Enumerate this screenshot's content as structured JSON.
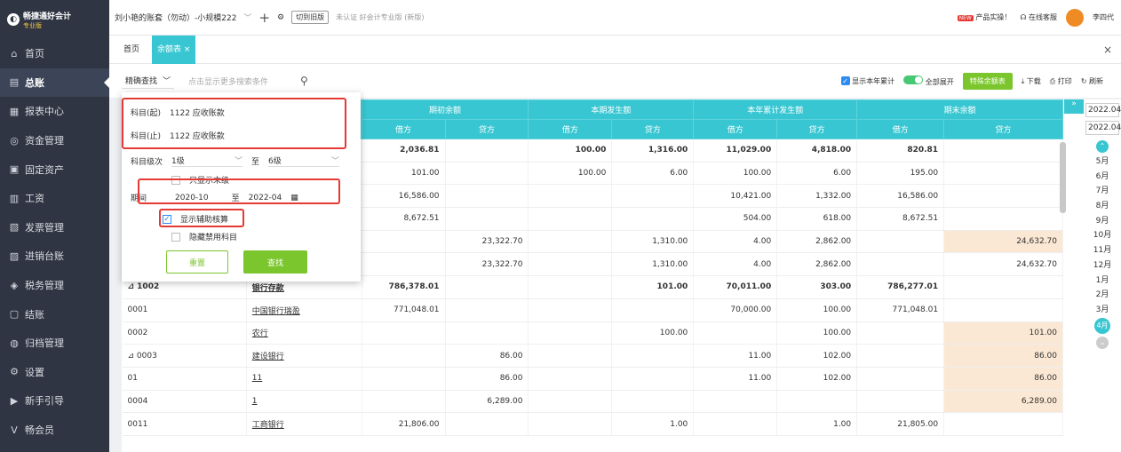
{
  "brand": {
    "name": "畅捷通好会计",
    "edition": "专业版"
  },
  "sidebar": {
    "items": [
      {
        "label": "首页",
        "icon": "home-icon",
        "glyph": "⌂"
      },
      {
        "label": "总账",
        "icon": "ledger-icon",
        "glyph": "▤",
        "active": true
      },
      {
        "label": "报表中心",
        "icon": "chart-icon",
        "glyph": "▦"
      },
      {
        "label": "资金管理",
        "icon": "fund-icon",
        "glyph": "◎"
      },
      {
        "label": "固定资产",
        "icon": "asset-icon",
        "glyph": "▣"
      },
      {
        "label": "工资",
        "icon": "salary-icon",
        "glyph": "▥"
      },
      {
        "label": "发票管理",
        "icon": "invoice-icon",
        "glyph": "▧"
      },
      {
        "label": "进销台账",
        "icon": "inventory-icon",
        "glyph": "▨"
      },
      {
        "label": "税务管理",
        "icon": "tax-icon",
        "glyph": "◈"
      },
      {
        "label": "结账",
        "icon": "close-book-icon",
        "glyph": "▢"
      },
      {
        "label": "归档管理",
        "icon": "archive-icon",
        "glyph": "◍"
      },
      {
        "label": "设置",
        "icon": "settings-icon",
        "glyph": "⚙"
      },
      {
        "label": "新手引导",
        "icon": "guide-icon",
        "glyph": "▶"
      },
      {
        "label": "畅会员",
        "icon": "vip-icon",
        "glyph": "V"
      }
    ]
  },
  "topbar": {
    "account": "刘小艳的账套（勿动）-小规模222",
    "switch_old": "切到旧版",
    "unauth": "未认证 好会计专业版 (新版)",
    "promo": "产品实操！",
    "service": "在线客服",
    "user": "李四代"
  },
  "tabs": [
    "首页",
    "余额表 ×"
  ],
  "toolbar": {
    "mode": "精确查找",
    "placeholder": "点击显示更多搜索条件",
    "show_year": "显示本年累计",
    "expand_all": "全部展开",
    "special": "特殊余额表",
    "download": "下载",
    "print": "打印",
    "refresh": "刷新"
  },
  "filter": {
    "subj_from_label": "科目(起)",
    "subj_from": "1122 应收账款",
    "subj_to_label": "科目(止)",
    "subj_to": "1122 应收账款",
    "level_label": "科目级次",
    "level_from": "1级",
    "level_to_label": "至",
    "level_to": "6级",
    "only_leaf": "只显示末级",
    "period_label": "期间",
    "period_from": "2020-10",
    "period_sep": "至",
    "period_to": "2022-04",
    "aux": "显示辅助核算",
    "hide_disabled": "隐藏禁用科目",
    "reset": "重置",
    "search": "查找"
  },
  "table": {
    "groups": [
      "期初余额",
      "本期发生额",
      "本年累计发生额",
      "期末余额"
    ],
    "sub": [
      "借方",
      "贷方",
      "借方",
      "贷方",
      "借方",
      "贷方",
      "借方",
      "贷方"
    ],
    "rows": [
      {
        "code": "",
        "name": "",
        "v": [
          "2,036.81",
          "",
          "100.00",
          "1,316.00",
          "11,029.00",
          "4,818.00",
          "820.81",
          ""
        ],
        "bold": true
      },
      {
        "code": "",
        "name": "",
        "v": [
          "101.00",
          "",
          "100.00",
          "6.00",
          "100.00",
          "6.00",
          "195.00",
          ""
        ]
      },
      {
        "code": "",
        "name": "",
        "v": [
          "16,586.00",
          "",
          "",
          "",
          "10,421.00",
          "1,332.00",
          "16,586.00",
          ""
        ]
      },
      {
        "code": "",
        "name": "",
        "v": [
          "8,672.51",
          "",
          "",
          "",
          "504.00",
          "618.00",
          "8,672.51",
          ""
        ]
      },
      {
        "code": "",
        "name": "",
        "v": [
          "",
          "23,322.70",
          "",
          "1,310.00",
          "4.00",
          "2,862.00",
          "",
          "24,632.70"
        ],
        "peach": true
      },
      {
        "code": "",
        "name": "",
        "v": [
          "",
          "23,322.70",
          "",
          "1,310.00",
          "4.00",
          "2,862.00",
          "",
          "24,632.70"
        ]
      },
      {
        "code": "⊿ 1002",
        "name": "银行存款",
        "v": [
          "786,378.01",
          "",
          "",
          "101.00",
          "70,011.00",
          "303.00",
          "786,277.01",
          ""
        ],
        "bold": true
      },
      {
        "code": "0001",
        "name": "中国银行瑞盈",
        "v": [
          "771,048.01",
          "",
          "",
          "",
          "70,000.00",
          "100.00",
          "771,048.01",
          ""
        ]
      },
      {
        "code": "0002",
        "name": "农行",
        "v": [
          "",
          "",
          "",
          "100.00",
          "",
          "100.00",
          "",
          "101.00"
        ],
        "peach": true
      },
      {
        "code": "⊿ 0003",
        "name": "建设银行",
        "v": [
          "",
          "86.00",
          "",
          "",
          "11.00",
          "102.00",
          "",
          "86.00"
        ],
        "peach": true
      },
      {
        "code": "01",
        "name": "11",
        "v": [
          "",
          "86.00",
          "",
          "",
          "11.00",
          "102.00",
          "",
          "86.00"
        ],
        "peach": true
      },
      {
        "code": "0004",
        "name": "1",
        "v": [
          "",
          "6,289.00",
          "",
          "",
          "",
          "",
          "",
          "6,289.00"
        ],
        "peach": true
      },
      {
        "code": "0011",
        "name": "工商银行",
        "v": [
          "21,806.00",
          "",
          "",
          "1.00",
          "",
          "1.00",
          "21,805.00",
          ""
        ]
      }
    ]
  },
  "timeline": {
    "year": "2022.04",
    "year2": "2022.04",
    "months": [
      "5月",
      "6月",
      "7月",
      "8月",
      "9月",
      "10月",
      "11月",
      "12月",
      "1月",
      "2月",
      "3月"
    ],
    "current": "4月"
  }
}
